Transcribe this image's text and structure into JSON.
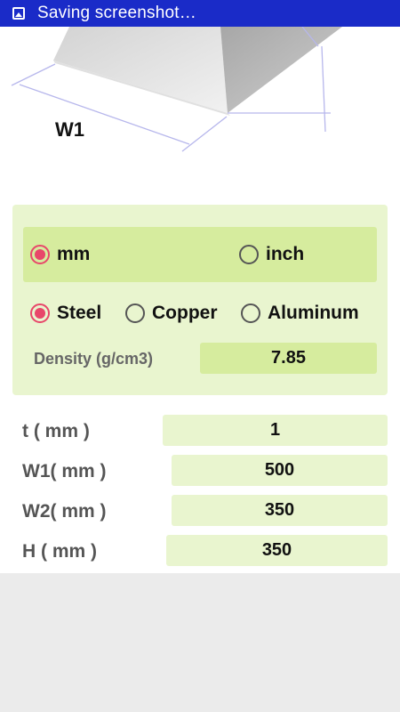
{
  "status_bar": {
    "text": "Saving screenshot…",
    "icon": "image-icon"
  },
  "diagram": {
    "w1_label": "W1"
  },
  "units": {
    "options": [
      {
        "label": "mm",
        "selected": true
      },
      {
        "label": "inch",
        "selected": false
      }
    ]
  },
  "materials": {
    "options": [
      {
        "label": "Steel",
        "selected": true
      },
      {
        "label": "Copper",
        "selected": false
      },
      {
        "label": "Aluminum",
        "selected": false
      }
    ]
  },
  "density": {
    "label": "Density (g/cm3)",
    "value": "7.85"
  },
  "fields": [
    {
      "label": "t ( mm )",
      "value": "1"
    },
    {
      "label": "W1( mm )",
      "value": "500"
    },
    {
      "label": "W2( mm )",
      "value": "350"
    },
    {
      "label": "H ( mm )",
      "value": "350"
    }
  ],
  "colors": {
    "status_bar": "#1a2bc8",
    "accent": "#e8476a",
    "panel": "#e9f5cf",
    "highlight": "#d6ec9e"
  }
}
